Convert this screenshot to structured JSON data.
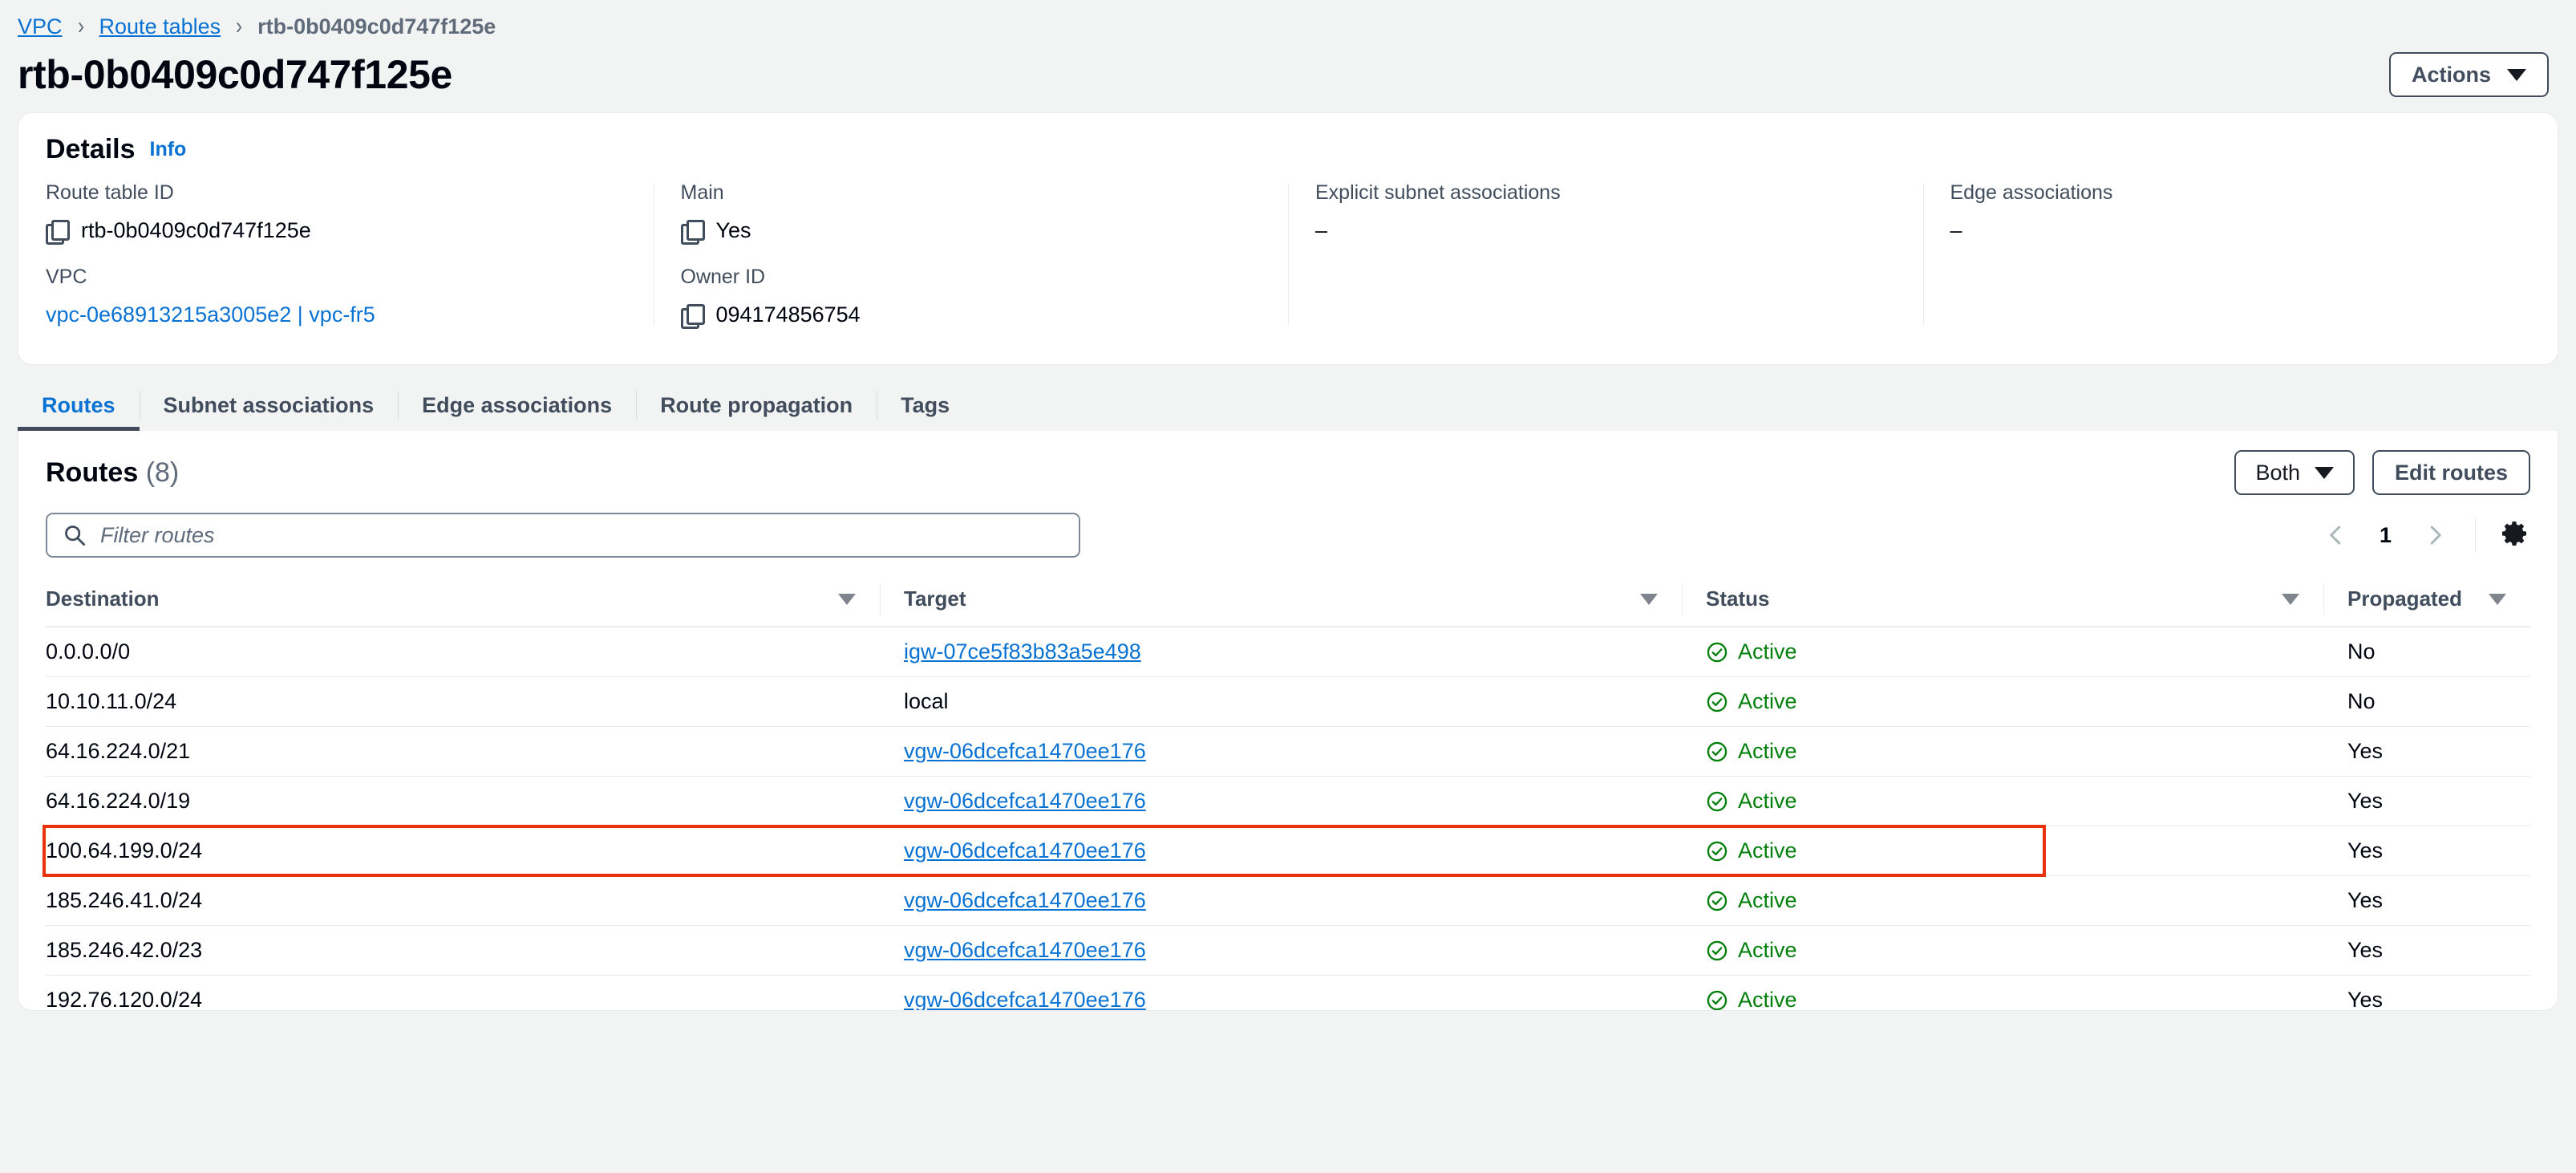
{
  "breadcrumb": {
    "items": [
      {
        "label": "VPC",
        "type": "link"
      },
      {
        "label": "Route tables",
        "type": "link"
      },
      {
        "label": "rtb-0b0409c0d747f125e",
        "type": "current"
      }
    ],
    "separator": "›"
  },
  "header": {
    "title": "rtb-0b0409c0d747f125e",
    "actions_label": "Actions"
  },
  "details": {
    "title": "Details",
    "info_label": "Info",
    "fields": {
      "route_table_id": {
        "label": "Route table ID",
        "value": "rtb-0b0409c0d747f125e",
        "icon": "copy-icon"
      },
      "vpc": {
        "label": "VPC",
        "value": "vpc-0e68913215a3005e2 | vpc-fr5"
      },
      "main": {
        "label": "Main",
        "value": "Yes",
        "icon": "copy-icon"
      },
      "owner_id": {
        "label": "Owner ID",
        "value": "094174856754",
        "icon": "copy-icon"
      },
      "explicit_subnet_associations": {
        "label": "Explicit subnet associations",
        "value": "–"
      },
      "edge_associations": {
        "label": "Edge associations",
        "value": "–"
      }
    }
  },
  "tabs": [
    {
      "label": "Routes",
      "active": true
    },
    {
      "label": "Subnet associations",
      "active": false
    },
    {
      "label": "Edge associations",
      "active": false
    },
    {
      "label": "Route propagation",
      "active": false
    },
    {
      "label": "Tags",
      "active": false
    }
  ],
  "routes_panel": {
    "title": "Routes",
    "count": "(8)",
    "both_label": "Both",
    "edit_routes_label": "Edit routes",
    "search": {
      "placeholder": "Filter routes",
      "value": "",
      "icon": "search-icon"
    },
    "pagination": {
      "prev_icon": "chevron-left-icon",
      "page": "1",
      "next_icon": "chevron-right-icon",
      "settings_icon": "gear-icon"
    },
    "columns": [
      {
        "label": "Destination",
        "sort_icon": "sort-descending-icon"
      },
      {
        "label": "Target",
        "sort_icon": "sort-descending-icon"
      },
      {
        "label": "Status",
        "sort_icon": "sort-descending-icon"
      },
      {
        "label": "Propagated",
        "sort_icon": "sort-descending-icon"
      }
    ],
    "rows": [
      {
        "destination": "0.0.0.0/0",
        "target": "igw-07ce5f83b83a5e498",
        "target_is_link": true,
        "status": "Active",
        "propagated": "No",
        "highlighted": false
      },
      {
        "destination": "10.10.11.0/24",
        "target": "local",
        "target_is_link": false,
        "status": "Active",
        "propagated": "No",
        "highlighted": false
      },
      {
        "destination": "64.16.224.0/21",
        "target": "vgw-06dcefca1470ee176",
        "target_is_link": true,
        "status": "Active",
        "propagated": "Yes",
        "highlighted": false
      },
      {
        "destination": "64.16.224.0/19",
        "target": "vgw-06dcefca1470ee176",
        "target_is_link": true,
        "status": "Active",
        "propagated": "Yes",
        "highlighted": false
      },
      {
        "destination": "100.64.199.0/24",
        "target": "vgw-06dcefca1470ee176",
        "target_is_link": true,
        "status": "Active",
        "propagated": "Yes",
        "highlighted": true
      },
      {
        "destination": "185.246.41.0/24",
        "target": "vgw-06dcefca1470ee176",
        "target_is_link": true,
        "status": "Active",
        "propagated": "Yes",
        "highlighted": false
      },
      {
        "destination": "185.246.42.0/23",
        "target": "vgw-06dcefca1470ee176",
        "target_is_link": true,
        "status": "Active",
        "propagated": "Yes",
        "highlighted": false
      },
      {
        "destination": "192.76.120.0/24",
        "target": "vgw-06dcefca1470ee176",
        "target_is_link": true,
        "status": "Active",
        "propagated": "Yes",
        "highlighted": false
      }
    ]
  },
  "colors": {
    "link": "#0972d3",
    "status_active": "#037f0c",
    "highlight_border": "#e8320c",
    "page_background": "#f2f3f3",
    "text": "#000510",
    "label_text": "#414d5c"
  }
}
